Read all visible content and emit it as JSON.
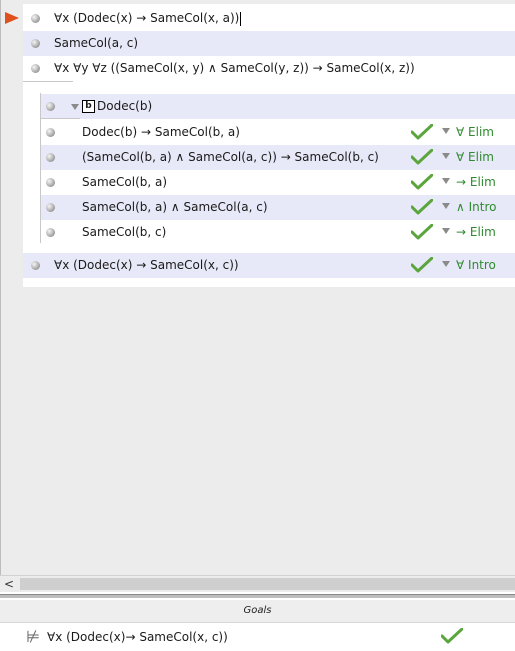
{
  "proof": {
    "premises": [
      {
        "sentence": "∀x (Dodec(x) → SameCol(x, a))"
      },
      {
        "sentence": "SameCol(a, c)"
      },
      {
        "sentence": "∀x ∀y ∀z ((SameCol(x, y) ∧ SameCol(y, z)) → SameCol(x, z))"
      }
    ],
    "subproof": {
      "box_constant": "b",
      "assumption": "Dodec(b)",
      "steps": [
        {
          "sentence": "Dodec(b) → SameCol(b, a)",
          "rule": "∀ Elim"
        },
        {
          "sentence": "(SameCol(b, a) ∧ SameCol(a, c)) → SameCol(b, c)",
          "rule": "∀ Elim"
        },
        {
          "sentence": "SameCol(b, a)",
          "rule": "→ Elim"
        },
        {
          "sentence": "SameCol(b, a) ∧ SameCol(a, c)",
          "rule": "∧ Intro"
        },
        {
          "sentence": "SameCol(b, c)",
          "rule": "→ Elim"
        }
      ]
    },
    "conclusion": {
      "sentence": "∀x (Dodec(x) → SameCol(x, c))",
      "rule": "∀ Intro"
    }
  },
  "scrollbar": {
    "left_arrow": "<"
  },
  "goals": {
    "header": "Goals",
    "items": [
      {
        "sentence": "∀x (Dodec(x)→ SameCol(x, c))"
      }
    ]
  },
  "colors": {
    "check": "#5aa53c",
    "rule": "#2f8a2f",
    "pointer": "#e0501e",
    "shaded_row": "#e8e9f8"
  }
}
